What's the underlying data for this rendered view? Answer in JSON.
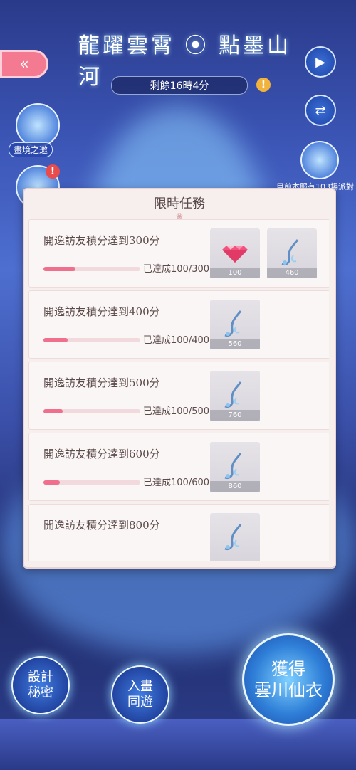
{
  "header": {
    "title": "龍躍雲霄 ⦿ 點墨山河",
    "countdown": "剩餘16時4分",
    "alert": "!"
  },
  "nav": {
    "back": "«",
    "play": "▶",
    "swap": "⇄"
  },
  "side": {
    "feature_label": "畫境之邀",
    "alert": "!",
    "notice": "目前本服有103場派對"
  },
  "modal": {
    "title": "限時任務",
    "deco": "❀"
  },
  "tasks": [
    {
      "title": "開逸訪友積分達到300分",
      "progress_text": "已達成100/300",
      "progress": 0.333,
      "rewards": [
        {
          "icon": "gem-icon",
          "qty": "100"
        },
        {
          "icon": "ribbon-icon",
          "qty": "460"
        }
      ]
    },
    {
      "title": "開逸訪友積分達到400分",
      "progress_text": "已達成100/400",
      "progress": 0.25,
      "rewards": [
        {
          "icon": "ribbon-icon",
          "qty": "560"
        }
      ]
    },
    {
      "title": "開逸訪友積分達到500分",
      "progress_text": "已達成100/500",
      "progress": 0.2,
      "rewards": [
        {
          "icon": "ribbon-icon",
          "qty": "760"
        }
      ]
    },
    {
      "title": "開逸訪友積分達到600分",
      "progress_text": "已達成100/600",
      "progress": 0.167,
      "rewards": [
        {
          "icon": "ribbon-icon",
          "qty": "860"
        }
      ]
    },
    {
      "title": "開逸訪友積分達到800分",
      "progress_text": "",
      "progress": null,
      "rewards": [
        {
          "icon": "ribbon-icon",
          "qty": ""
        }
      ]
    }
  ],
  "bottom": {
    "design": "設計\n秘密",
    "enter": "入畫\n同遊",
    "obtain": "獲得\n雲川仙衣"
  },
  "colors": {
    "accent": "#ef6f8c",
    "modal_bg": "#f7eeee",
    "back_button": "#f47a92"
  }
}
